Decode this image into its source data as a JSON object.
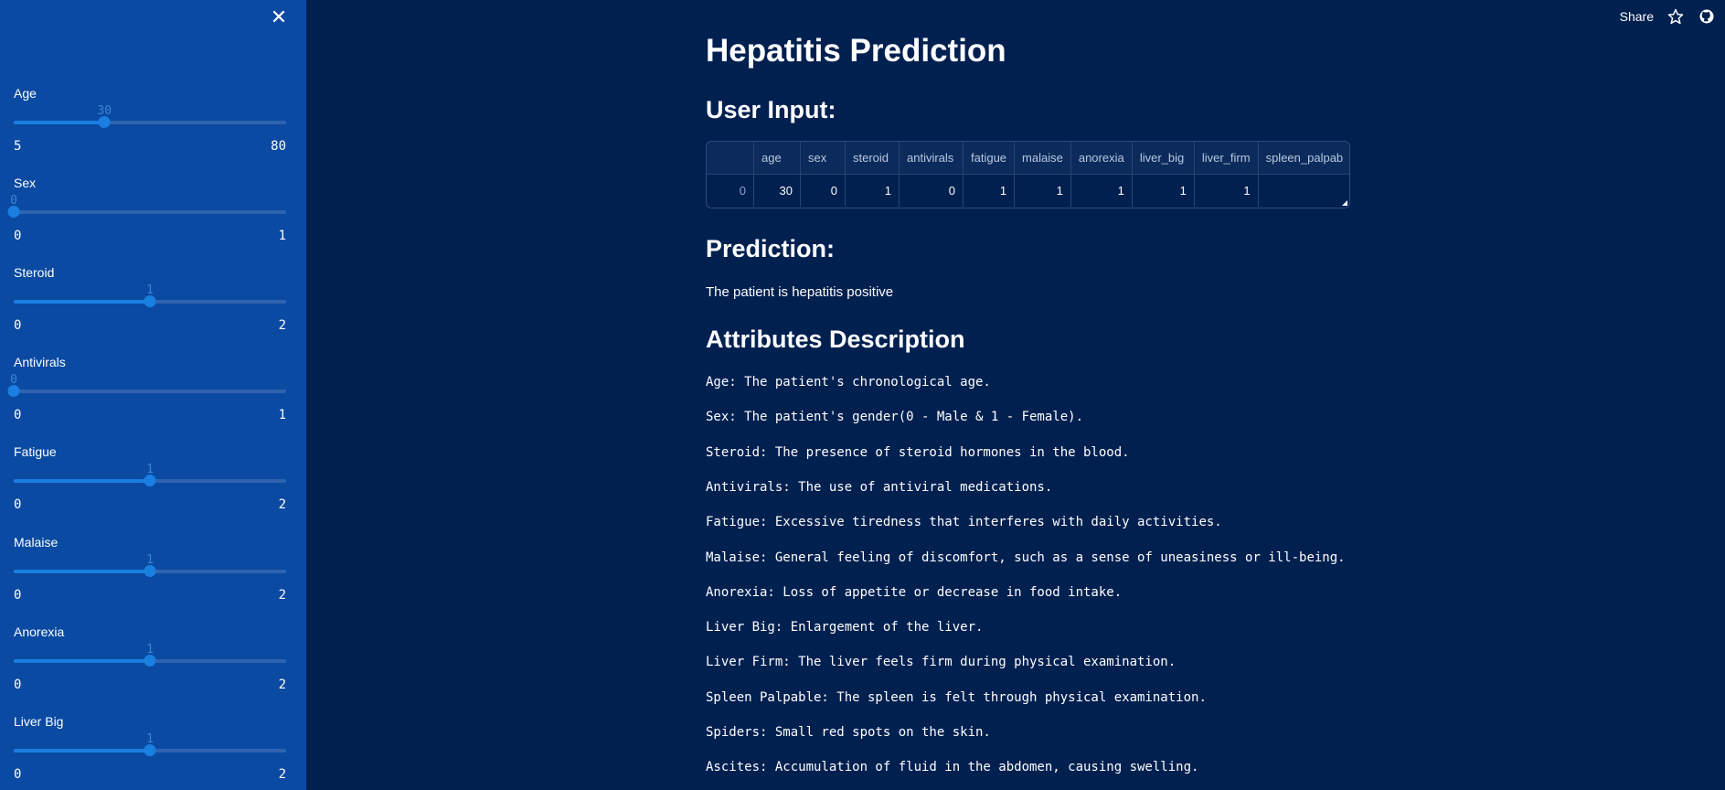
{
  "sidebar": {
    "close_label": "✕",
    "sliders": [
      {
        "label": "Age",
        "value": "30",
        "min": "5",
        "max": "80",
        "fraction": 0.333
      },
      {
        "label": "Sex",
        "value": "0",
        "min": "0",
        "max": "1",
        "fraction": 0.0
      },
      {
        "label": "Steroid",
        "value": "1",
        "min": "0",
        "max": "2",
        "fraction": 0.5
      },
      {
        "label": "Antivirals",
        "value": "0",
        "min": "0",
        "max": "1",
        "fraction": 0.0
      },
      {
        "label": "Fatigue",
        "value": "1",
        "min": "0",
        "max": "2",
        "fraction": 0.5
      },
      {
        "label": "Malaise",
        "value": "1",
        "min": "0",
        "max": "2",
        "fraction": 0.5
      },
      {
        "label": "Anorexia",
        "value": "1",
        "min": "0",
        "max": "2",
        "fraction": 0.5
      },
      {
        "label": "Liver Big",
        "value": "1",
        "min": "0",
        "max": "2",
        "fraction": 0.5
      }
    ]
  },
  "topbar": {
    "share_label": "Share",
    "icons": [
      "star-icon",
      "github-icon"
    ]
  },
  "main": {
    "title": "Hepatitis Prediction",
    "user_input_heading": "User Input:",
    "table": {
      "columns": [
        "",
        "age",
        "sex",
        "steroid",
        "antivirals",
        "fatigue",
        "malaise",
        "anorexia",
        "liver_big",
        "liver_firm",
        "spleen_palpab"
      ],
      "rows": [
        [
          "0",
          "30",
          "0",
          "1",
          "0",
          "1",
          "1",
          "1",
          "1",
          "1",
          ""
        ]
      ]
    },
    "prediction_heading": "Prediction:",
    "prediction_text": "The patient is hepatitis positive",
    "attributes_heading": "Attributes Description",
    "descriptions": [
      "Age: The patient's chronological age.",
      "Sex: The patient's gender(0 - Male & 1 - Female).",
      "Steroid: The presence of steroid hormones in the blood.",
      "Antivirals: The use of antiviral medications.",
      "Fatigue: Excessive tiredness that interferes with daily activities.",
      "Malaise: General feeling of discomfort, such as a sense of uneasiness or ill-being.",
      "Anorexia: Loss of appetite or decrease in food intake.",
      "Liver Big: Enlargement of the liver.",
      "Liver Firm: The liver feels firm during physical examination.",
      "Spleen Palpable: The spleen is felt through physical examination.",
      "Spiders: Small red spots on the skin.",
      "Ascites: Accumulation of fluid in the abdomen, causing swelling."
    ]
  },
  "colors": {
    "background": "#002050",
    "sidebar": "#0a4aa2",
    "accent": "#1a7fe0"
  }
}
